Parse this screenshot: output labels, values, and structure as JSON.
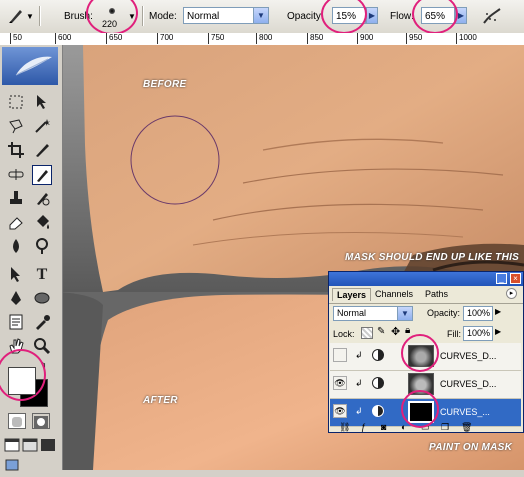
{
  "options_bar": {
    "brush_label": "Brush:",
    "brush_size": "220",
    "mode_label": "Mode:",
    "mode_value": "Normal",
    "opacity_label": "Opacity:",
    "opacity_value": "15%",
    "flow_label": "Flow:",
    "flow_value": "65%"
  },
  "ruler": {
    "ticks": [
      "50",
      "600",
      "650",
      "700",
      "750",
      "800",
      "850",
      "900",
      "950",
      "1000"
    ]
  },
  "photo": {
    "before_label": "BEFORE",
    "after_label": "AFTER",
    "mask_note": "MASK SHOULD END UP LIKE THIS",
    "paint_note": "PAINT ON MASK"
  },
  "layers_panel": {
    "tabs": [
      "Layers",
      "Channels",
      "Paths"
    ],
    "blend_mode": "Normal",
    "opacity_label": "Opacity:",
    "opacity_value": "100%",
    "lock_label": "Lock:",
    "fill_label": "Fill:",
    "fill_value": "100%",
    "layers": [
      {
        "name": "CURVES_D...",
        "visible": false,
        "selected": false
      },
      {
        "name": "CURVES_D...",
        "visible": true,
        "selected": false
      },
      {
        "name": "CURVES_...",
        "visible": true,
        "selected": true
      }
    ]
  },
  "colors": {
    "accent_ring": "#e0207c",
    "selection": "#316ac5",
    "panel_border": "#0a246a"
  }
}
